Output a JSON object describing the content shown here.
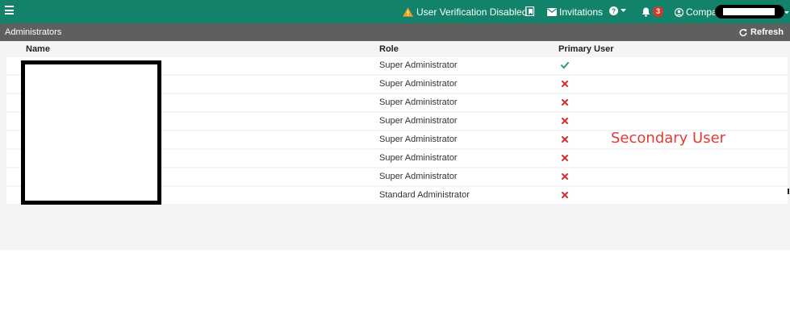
{
  "topbar": {
    "warning_label": "User Verification Disabled",
    "invitations_label": "Invitations",
    "notifications_count": "3",
    "company_label": "Compar",
    "bg_color": "#12836a"
  },
  "section": {
    "title": "Administrators",
    "refresh_label": "Refresh"
  },
  "table": {
    "columns": [
      "Name",
      "Role",
      "Primary User"
    ],
    "rows": [
      {
        "name": "",
        "role": "Super Administrator",
        "primary_user": "check-icon"
      },
      {
        "name": "",
        "role": "Super Administrator",
        "primary_user": "x-icon"
      },
      {
        "name": "",
        "role": "Super Administrator",
        "primary_user": "x-icon"
      },
      {
        "name": "",
        "role": "Super Administrator",
        "primary_user": "x-icon"
      },
      {
        "name": "",
        "role": "Super Administrator",
        "primary_user": "x-icon"
      },
      {
        "name": "",
        "role": "Super Administrator",
        "primary_user": "x-icon"
      },
      {
        "name": "",
        "role": "Super Administrator",
        "primary_user": "x-icon"
      },
      {
        "name": "",
        "role": "Standard Administrator",
        "primary_user": "x-icon"
      }
    ]
  },
  "annotation": {
    "text": "Secondary User",
    "color": "#e53935"
  },
  "colors": {
    "check": "#2e9d6a",
    "cross": "#d32f2f",
    "warning": "#f0a020"
  }
}
